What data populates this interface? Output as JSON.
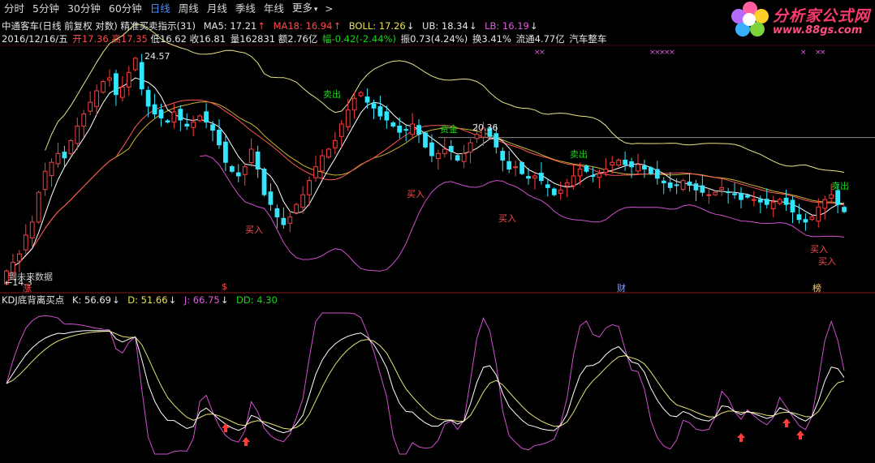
{
  "toolbar": {
    "tabs": [
      {
        "label": "分时",
        "active": false
      },
      {
        "label": "5分钟",
        "active": false
      },
      {
        "label": "30分钟",
        "active": false
      },
      {
        "label": "60分钟",
        "active": false
      },
      {
        "label": "日线",
        "active": true
      },
      {
        "label": "周线",
        "active": false
      },
      {
        "label": "月线",
        "active": false
      },
      {
        "label": "季线",
        "active": false
      },
      {
        "label": "年线",
        "active": false
      }
    ],
    "more_label": "更多",
    "next_label": ">"
  },
  "logo": {
    "name": "分析家公式网",
    "url_text": "www.88gs.com"
  },
  "header": {
    "title": "中通客车(日线 前复权 对数) 精准买卖指示(31)",
    "ma5": "MA5: 17.21",
    "ma18": "MA18: 16.94",
    "boll": "BOLL: 17.26",
    "ub": "UB: 18.34",
    "lb": "LB: 16.19"
  },
  "quote": {
    "date": "2016/12/16/五",
    "open": "开17.36",
    "high": "高17.35",
    "low": "低16.62",
    "close": "收16.81",
    "volume": "量162831",
    "amount": "额2.76亿",
    "change": "幅-0.42(-2.44%)",
    "amplitude": "振0.73(4.24%)",
    "turnover": "换3.41%",
    "float": "流通4.77亿",
    "sector": "汽车整车"
  },
  "main_chart": {
    "annotations": {
      "high_label": "24.57",
      "low_label": "←14.3",
      "level_label": "20.36",
      "level_tag": "资金",
      "future_note": "到未来数据",
      "markers": [
        {
          "text": "涨",
          "color": "#ff4a4a"
        },
        {
          "text": "$",
          "color": "#ff4a4a"
        },
        {
          "text": "财",
          "color": "#7fa0ff"
        },
        {
          "text": "榜",
          "color": "#ffcc66"
        }
      ],
      "signals": [
        {
          "text": "卖出",
          "kind": "sell"
        },
        {
          "text": "卖出",
          "kind": "sell"
        },
        {
          "text": "卖出",
          "kind": "sell"
        },
        {
          "text": "买入",
          "kind": "buy"
        },
        {
          "text": "买入",
          "kind": "buy"
        },
        {
          "text": "买入",
          "kind": "buy"
        },
        {
          "text": "买入",
          "kind": "buy"
        },
        {
          "text": "买入",
          "kind": "buy"
        }
      ]
    },
    "colors": {
      "up": "#ff3c3c",
      "down": "#33e6ff",
      "ma5": "#ffffff",
      "ma18": "#ff5555",
      "boll": "#c8b430",
      "ub": "#e8e48a",
      "lb": "#d050d0",
      "level": "#8a8a8a"
    }
  },
  "indicator": {
    "title": "KDJ底背离买点",
    "k": "K: 56.69",
    "d": "D: 51.66",
    "j": "J: 66.75",
    "dd": "DD: 4.30",
    "colors": {
      "k": "#ffffff",
      "d": "#e8e17a",
      "j": "#d050d0",
      "arrow": "#ff3c3c"
    }
  },
  "chart_data": {
    "type": "candlestick",
    "title": "中通客车(日线 前复权 对数)",
    "y_log": true,
    "ylim": [
      14.3,
      24.57
    ],
    "indicator": {
      "name": "KDJ",
      "last": {
        "k": 56.69,
        "d": 51.66,
        "j": 66.75,
        "dd": 4.3
      }
    },
    "last_bar": {
      "date": "2016/12/16",
      "open": 17.36,
      "high": 17.35,
      "low": 16.62,
      "close": 16.81,
      "volume": 162831
    },
    "level": 20.36,
    "closes": [
      14.6,
      14.9,
      15.2,
      15.9,
      16.4,
      17.6,
      18.5,
      18.9,
      19.3,
      19.1,
      19.9,
      20.6,
      21.2,
      21.8,
      22.4,
      22.9,
      23.1,
      22.2,
      22.6,
      23.4,
      24.2,
      22.5,
      21.6,
      21.2,
      21.0,
      20.8,
      21.3,
      20.9,
      20.6,
      20.8,
      21.1,
      20.8,
      20.4,
      19.7,
      18.9,
      18.5,
      18.3,
      18.7,
      19.5,
      18.6,
      17.5,
      17.1,
      16.6,
      16.3,
      16.6,
      17.1,
      17.5,
      18.1,
      18.7,
      19.2,
      19.5,
      19.9,
      20.7,
      21.4,
      22.0,
      22.3,
      21.8,
      21.5,
      21.1,
      20.9,
      20.6,
      20.3,
      20.4,
      20.7,
      20.2,
      19.6,
      19.2,
      19.3,
      19.5,
      19.4,
      19.0,
      19.3,
      19.8,
      20.2,
      20.5,
      20.1,
      19.6,
      19.0,
      18.6,
      18.7,
      18.4,
      18.2,
      18.3,
      18.1,
      17.8,
      17.5,
      17.7,
      18.0,
      18.3,
      18.6,
      18.5,
      18.3,
      18.4,
      18.6,
      18.9,
      19.0,
      18.8,
      18.7,
      18.8,
      18.6,
      18.4,
      18.2,
      18.0,
      17.8,
      17.9,
      18.1,
      17.9,
      17.7,
      17.6,
      17.5,
      17.6,
      17.8,
      17.6,
      17.5,
      17.3,
      17.4,
      17.3,
      17.2,
      17.1,
      17.2,
      17.3,
      17.1,
      16.8,
      16.5,
      16.4,
      16.6,
      17.0,
      17.3,
      17.5,
      17.1,
      16.81
    ]
  }
}
